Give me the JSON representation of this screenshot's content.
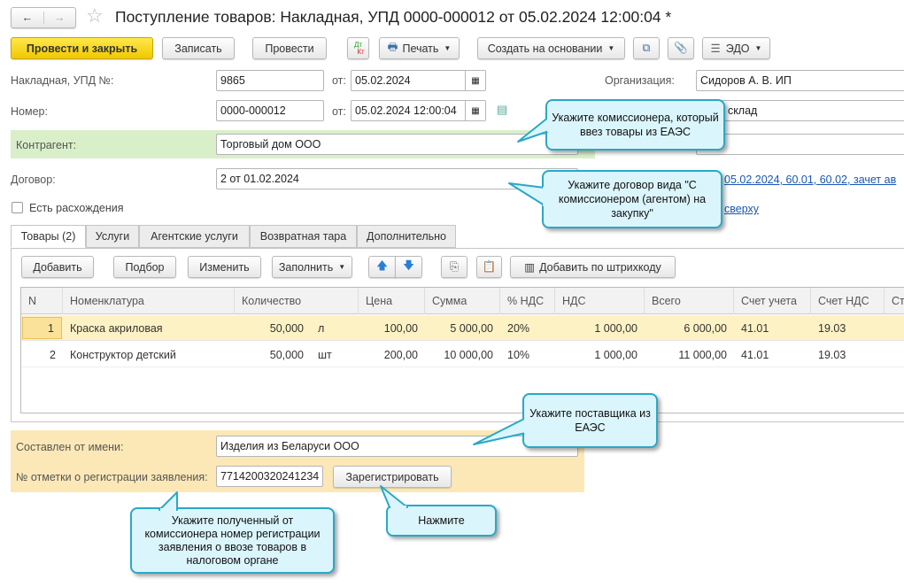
{
  "title": "Поступление товаров: Накладная, УПД 0000-000012 от 05.02.2024 12:00:04 *",
  "toolbar": {
    "post_close": "Провести и закрыть",
    "save": "Записать",
    "post": "Провести",
    "dt": "Дт",
    "kt": "Кт",
    "print": "Печать",
    "create_based": "Создать на основании",
    "edo": "ЭДО"
  },
  "form": {
    "invoice_label": "Накладная, УПД №:",
    "invoice_no": "9865",
    "from_label": "от:",
    "invoice_date": "05.02.2024",
    "number_label": "Номер:",
    "number": "0000-000012",
    "number_date": "05.02.2024 12:00:04",
    "org_label": "Организация:",
    "org": "Сидоров А. В. ИП",
    "warehouse": "вной склад",
    "counterparty_label": "Контрагент:",
    "counterparty": "Торговый дом ООО",
    "contract_label": "Договор:",
    "contract": "2 от 01.02.2024",
    "settlements_link": "05.02.2024, 60.01, 60.02, зачет ав",
    "discrepancy_label": "Есть расхождения",
    "link2": "сверху"
  },
  "tabs": [
    "Товары (2)",
    "Услуги",
    "Агентские услуги",
    "Возвратная тара",
    "Дополнительно"
  ],
  "table_toolbar": {
    "add": "Добавить",
    "pick": "Подбор",
    "edit": "Изменить",
    "fill": "Заполнить",
    "add_barcode": "Добавить по штрихкоду"
  },
  "table": {
    "columns": [
      "N",
      "Номенклатура",
      "Количество",
      "Цена",
      "Сумма",
      "% НДС",
      "НДС",
      "Всего",
      "Счет учета",
      "Счет НДС",
      "Ст"
    ],
    "rows": [
      {
        "n": "1",
        "name": "Краска акриловая",
        "qty": "50,000",
        "unit": "л",
        "price": "100,00",
        "sum": "5 000,00",
        "vat_rate": "20%",
        "vat": "1 000,00",
        "total": "6 000,00",
        "account": "41.01",
        "vat_account": "19.03"
      },
      {
        "n": "2",
        "name": "Конструктор детский",
        "qty": "50,000",
        "unit": "шт",
        "price": "200,00",
        "sum": "10 000,00",
        "vat_rate": "10%",
        "vat": "1 000,00",
        "total": "11 000,00",
        "account": "41.01",
        "vat_account": "19.03"
      }
    ]
  },
  "bottom": {
    "on_behalf_label": "Составлен от имени:",
    "on_behalf": "Изделия из Беларуси ООО",
    "reg_label": "№ отметки о регистрации заявления:",
    "reg_no": "7714200320241234",
    "register": "Зарегистрировать"
  },
  "callouts": {
    "c1": "Укажите комиссионера, который ввез товары из ЕАЭС",
    "c2": "Укажите договор вида \"С комиссионером (агентом) на закупку\"",
    "c3": "Укажите поставщика из ЕАЭС",
    "c4": "Укажите полученный от комиссионера номер регистрации заявления о ввозе товаров в налоговом органе",
    "c5": "Нажмите"
  },
  "colors": {
    "accent": "#f5d614",
    "green_band": "#d9efc9",
    "yellow_band": "#fce8b6",
    "selected_row": "#fdf2c4",
    "callout": "#dbf5fc"
  }
}
